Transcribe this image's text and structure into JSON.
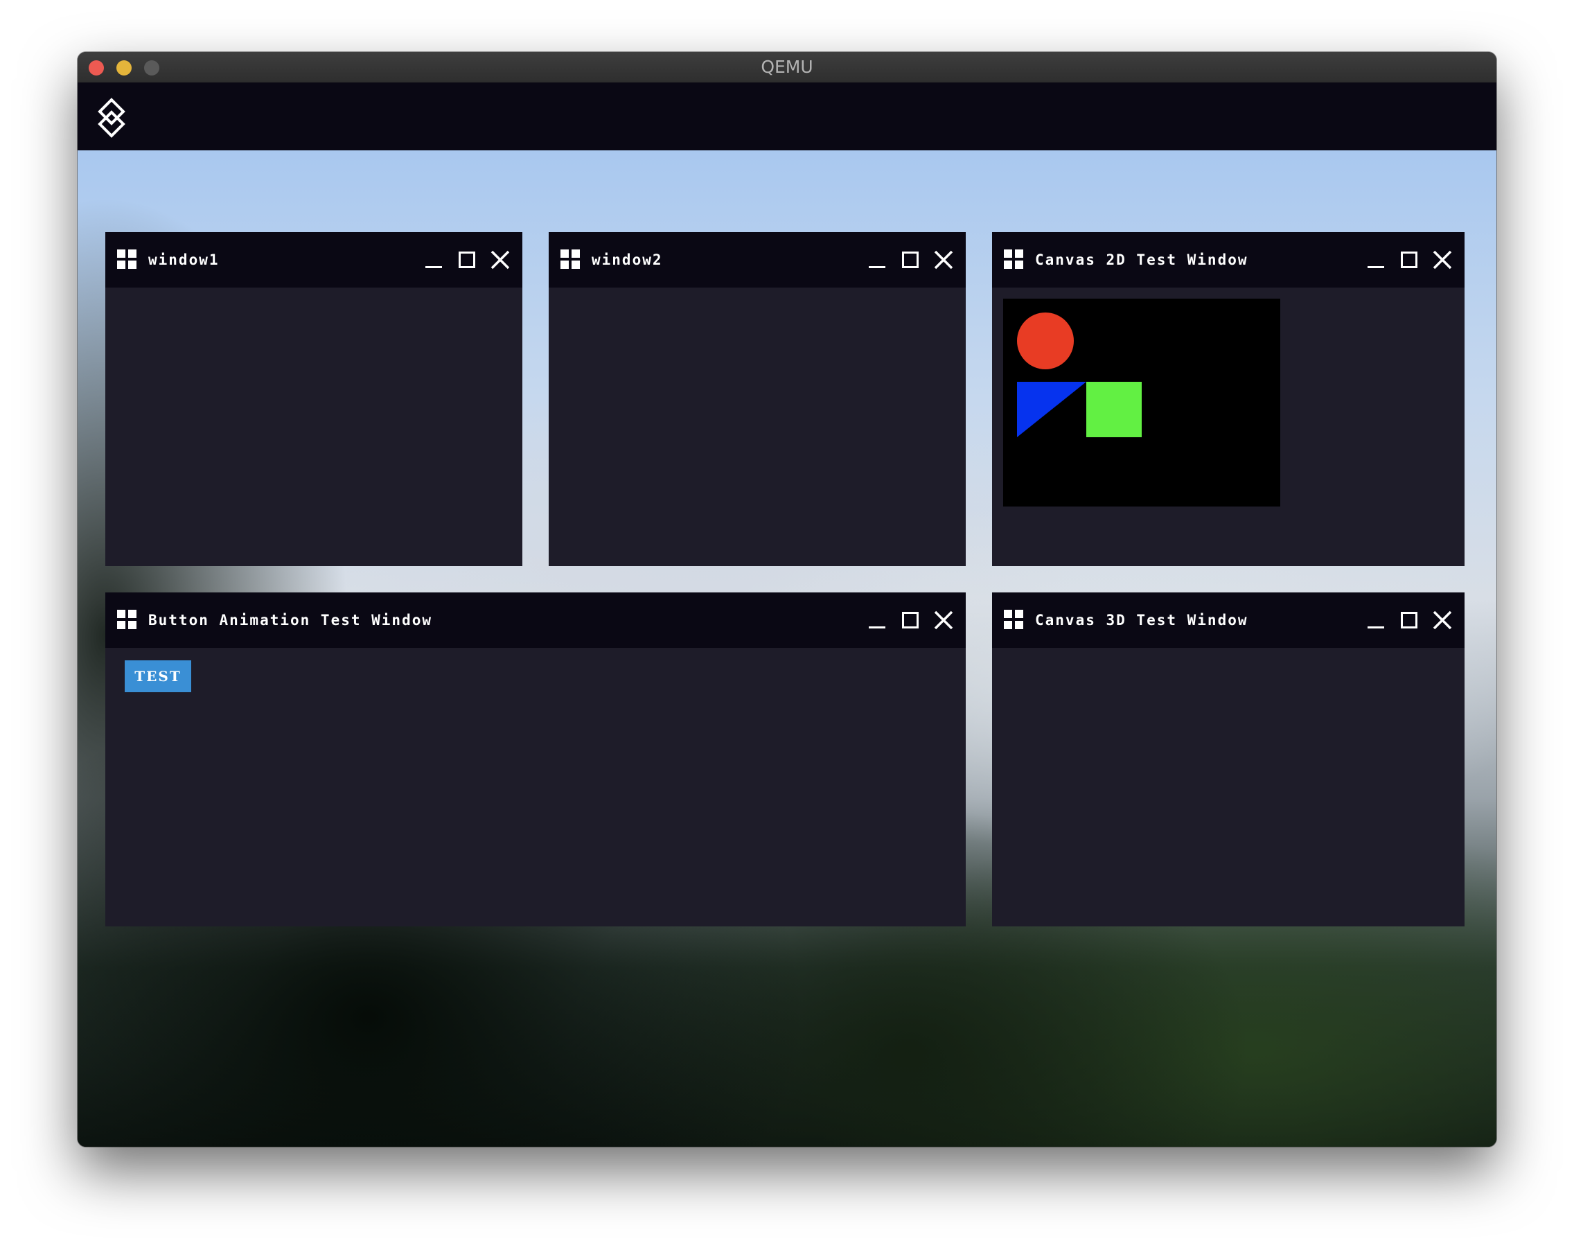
{
  "mac_window": {
    "title": "QEMU",
    "traffic_lights": [
      {
        "name": "close",
        "color": "#ed5a52"
      },
      {
        "name": "minimize",
        "color": "#e5b53b"
      },
      {
        "name": "zoom",
        "color": "#5a5a5a"
      }
    ]
  },
  "topbar": {
    "logo_icon": "diamond-logo-icon",
    "background": "#0a0814"
  },
  "colors": {
    "window_header": "#0a0814",
    "window_body": "#1e1c29",
    "button_accent": "#3a8fd5",
    "canvas_circle": "#e83c24",
    "canvas_triangle": "#0633ee",
    "canvas_square": "#62f043"
  },
  "windows": [
    {
      "id": "window1",
      "title": "window1",
      "icon": "grid-icon",
      "controls": [
        "minimize-icon",
        "maximize-icon",
        "close-icon"
      ]
    },
    {
      "id": "window2",
      "title": "window2",
      "icon": "grid-icon",
      "controls": [
        "minimize-icon",
        "maximize-icon",
        "close-icon"
      ]
    },
    {
      "id": "canvas2d",
      "title": "Canvas 2D Test Window",
      "icon": "grid-icon",
      "controls": [
        "minimize-icon",
        "maximize-icon",
        "close-icon"
      ],
      "canvas": {
        "background": "#000000",
        "shapes": [
          "red circle",
          "blue triangle",
          "green square"
        ]
      }
    },
    {
      "id": "button-anim",
      "title": "Button Animation Test Window",
      "icon": "grid-icon",
      "controls": [
        "minimize-icon",
        "maximize-icon",
        "close-icon"
      ],
      "button_label": "TEST"
    },
    {
      "id": "canvas3d",
      "title": "Canvas 3D Test Window",
      "icon": "grid-icon",
      "controls": [
        "minimize-icon",
        "maximize-icon",
        "close-icon"
      ]
    }
  ]
}
